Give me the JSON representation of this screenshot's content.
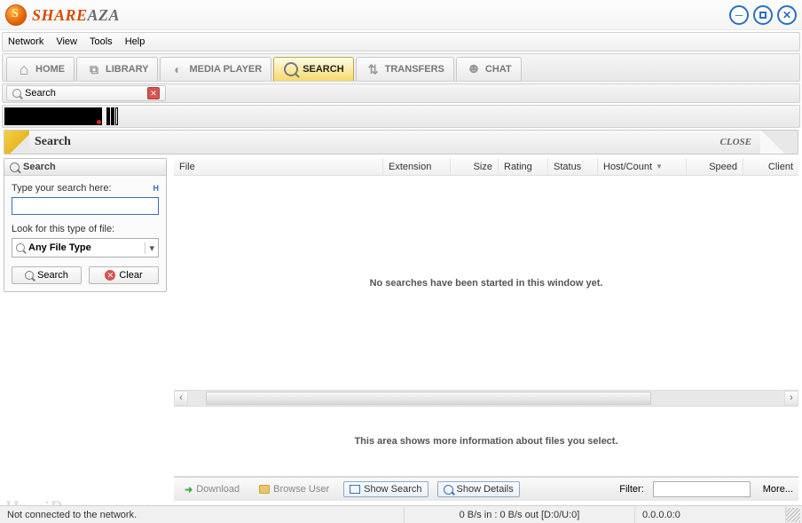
{
  "app": {
    "brand_prefix": "SHARE",
    "brand_suffix": "AZA"
  },
  "menu": {
    "network": "Network",
    "view": "View",
    "tools": "Tools",
    "help": "Help"
  },
  "tabs": {
    "home": "HOME",
    "library": "LIBRARY",
    "media": "MEDIA PLAYER",
    "search": "SEARCH",
    "transfers": "TRANSFERS",
    "chat": "CHAT"
  },
  "subtab": {
    "label": "Search"
  },
  "band": {
    "title": "Search",
    "close": "CLOSE"
  },
  "sidebar": {
    "header": "Search",
    "search_label": "Type your search here:",
    "hint": "H",
    "type_label": "Look for this type of file:",
    "type_value": "Any File Type",
    "btn_search": "Search",
    "btn_clear": "Clear"
  },
  "columns": {
    "file": "File",
    "extension": "Extension",
    "size": "Size",
    "rating": "Rating",
    "status": "Status",
    "hostcount": "Host/Count",
    "speed": "Speed",
    "client": "Client"
  },
  "empty_msg": "No searches have been started in this window yet.",
  "detail_msg": "This area shows more information about files you select.",
  "bottombar": {
    "download": "Download",
    "browse": "Browse User",
    "showsearch": "Show Search",
    "showdetails": "Show Details",
    "filter_label": "Filter:",
    "more": "More..."
  },
  "status": {
    "conn": "Not connected to the network.",
    "bw": "0 B/s in : 0 B/s out [D:0/U:0]",
    "ip": "0.0.0.0:0"
  },
  "watermark": "HamiRayane.com"
}
